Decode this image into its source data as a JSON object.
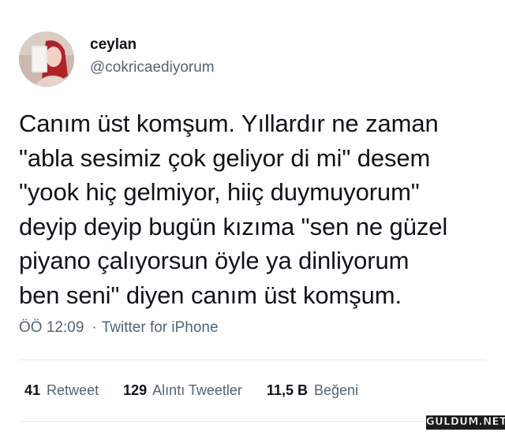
{
  "author": {
    "name": "ceylan",
    "handle": "@cokricaediyorum"
  },
  "tweet": {
    "text": "Canım üst komşum. Yıllardır ne zaman\n\"abla sesimiz çok geliyor di mi\" desem\n\"yook hiç gelmiyor, hiiç duymuyorum\"\ndeyip deyip bugün kızıma \"sen ne güzel\npiyano çalıyorsun öyle ya dinliyorum\nben seni\" diyen canım üst komşum.",
    "time": "ÖÖ 12:09",
    "separator": "·",
    "source": "Twitter for iPhone"
  },
  "stats": [
    {
      "count": "41",
      "label": "Retweet"
    },
    {
      "count": "129",
      "label": "Alıntı Tweetler"
    },
    {
      "count": "11,5 B",
      "label": "Beğeni"
    }
  ],
  "watermark": "GULDUM.NET"
}
